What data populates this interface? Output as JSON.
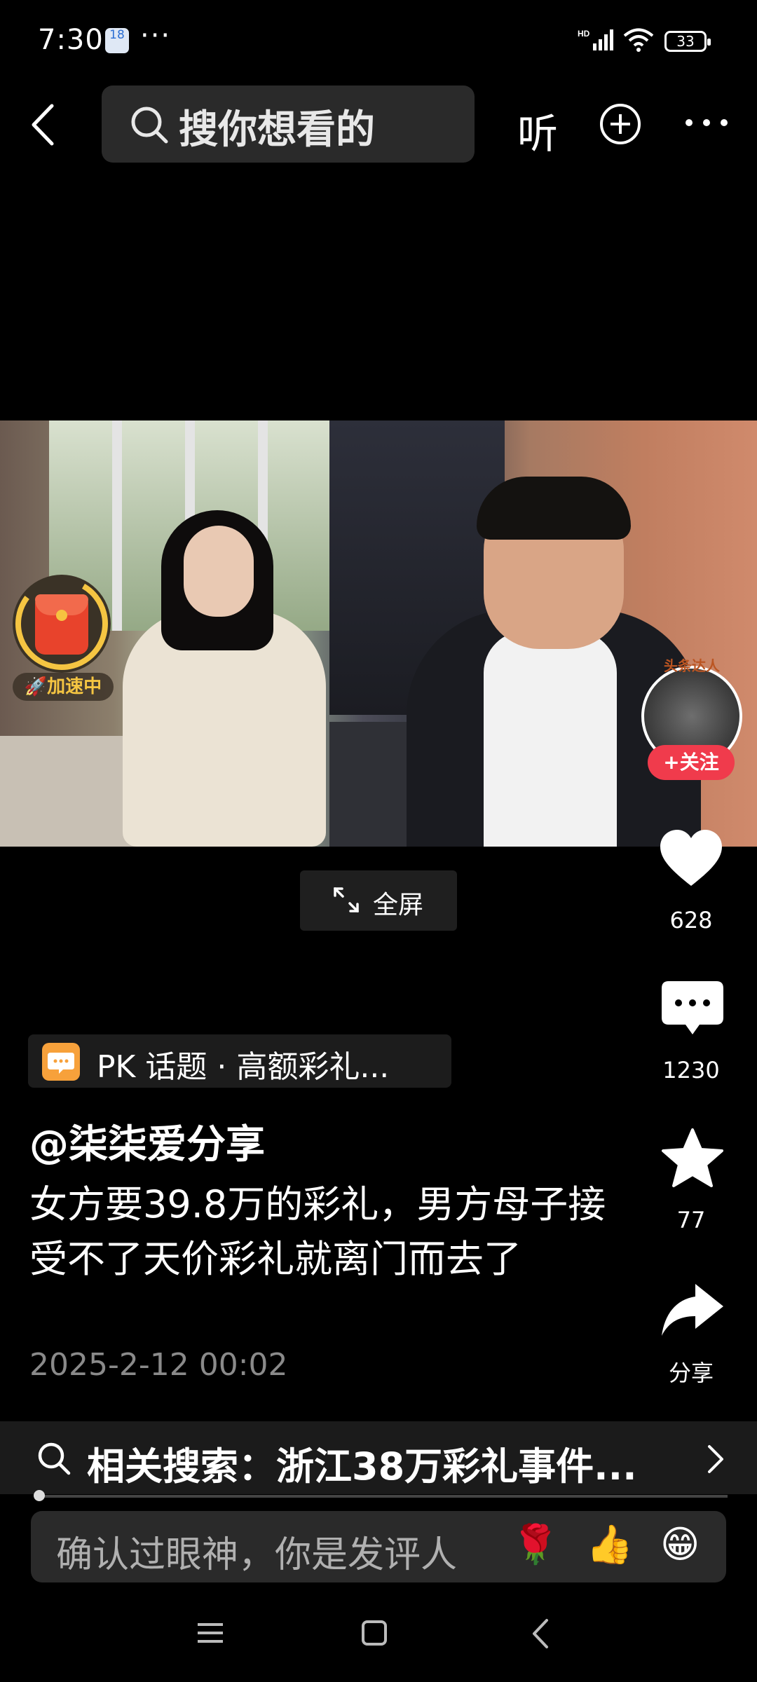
{
  "status_bar": {
    "time": "7:30",
    "calendar_day": "18",
    "notif_dots": "···",
    "network": "HD",
    "battery": "33"
  },
  "top_nav": {
    "search_placeholder": "搜你想看的",
    "listen_label": "听"
  },
  "video": {
    "red_packet_label": "🚀加速中",
    "avatar_badge": "头条达人",
    "follow_label": "+关注",
    "fullscreen_label": "全屏"
  },
  "actions": {
    "like_count": "628",
    "comment_count": "1230",
    "favorite_count": "77",
    "share_label": "分享"
  },
  "post": {
    "topic": "PK 话题 · 高额彩礼...",
    "author": "@柒柒爱分享",
    "description": "女方要39.8万的彩礼，男方母子接受不了天价彩礼就离门而去了",
    "date": "2025-2-12 00:02"
  },
  "related_search": {
    "text": "相关搜索：浙江38万彩礼事件..."
  },
  "comment": {
    "placeholder": "确认过眼神，你是发评人",
    "emojis": [
      "🌹",
      "👍",
      "😁"
    ]
  },
  "colors": {
    "background": "#000000",
    "follow_red": "#f03b4c",
    "topic_orange": "#f7a13b",
    "red_packet_gold": "#f5c542"
  },
  "icons": [
    "back-icon",
    "search-icon",
    "plus-circle-icon",
    "more-icon",
    "heart-icon",
    "comment-icon",
    "star-icon",
    "share-icon",
    "fullscreen-icon",
    "chevron-right-icon"
  ]
}
